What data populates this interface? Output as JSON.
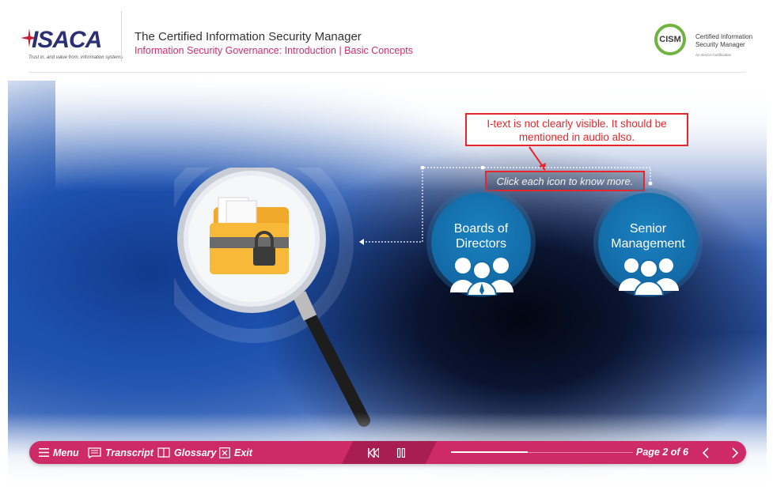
{
  "header": {
    "logo_text": "ISACA",
    "logo_tagline": "Trust in, and value from, information systems",
    "course_title": "The Certified Information Security Manager",
    "course_subtitle": "Information Security Governance: Introduction | Basic Concepts",
    "cism_badge": "CISM",
    "cism_line1": "Certified Information",
    "cism_line2": "Security Manager",
    "cism_line3": "An ISACA Certification",
    "brand_color": "#2b2f76",
    "accent_color": "#d12d6b",
    "cism_green": "#6fb43f"
  },
  "stage": {
    "feedback_note": "I-text is not clearly visible. It should be mentioned in audio also.",
    "instruction": "Click each icon to know more.",
    "illustration": "magnifier-over-locked-folder-icon",
    "icons": [
      {
        "label_line1": "Boards of",
        "label_line2": "Directors",
        "icon": "group-of-people-icon"
      },
      {
        "label_line1": "Senior",
        "label_line2": "Management",
        "icon": "group-of-people-icon"
      }
    ],
    "icon_color": "#126aa6",
    "feedback_color": "#e8262a"
  },
  "navbar": {
    "menu": "Menu",
    "transcript": "Transcript",
    "glossary": "Glossary",
    "exit": "Exit",
    "page_label": "Page 2 of 6",
    "current_page": 2,
    "total_pages": 6,
    "progress_fraction": 0.42,
    "bar_color": "#cd2a67"
  }
}
